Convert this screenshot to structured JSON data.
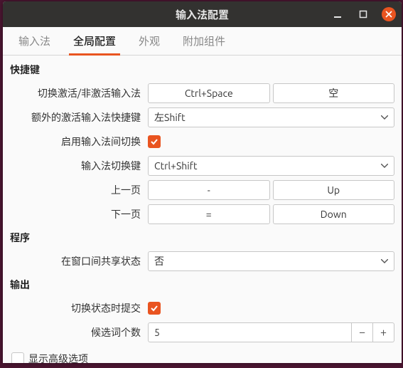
{
  "window": {
    "title": "输入法配置"
  },
  "tabs": [
    "输入法",
    "全局配置",
    "外观",
    "附加组件"
  ],
  "active_tab": 1,
  "sections": {
    "hotkey": {
      "header": "快捷键",
      "toggle_activate": {
        "label": "切换激活/非激活输入法",
        "key1": "Ctrl+Space",
        "key2": "空"
      },
      "extra_activate": {
        "label": "额外的激活输入法快捷键",
        "value": "左Shift"
      },
      "enable_switch": {
        "label": "启用输入法间切换",
        "checked": true
      },
      "switch_key": {
        "label": "输入法切换键",
        "value": "Ctrl+Shift"
      },
      "prev_page": {
        "label": "上一页",
        "key1": "-",
        "key2": "Up"
      },
      "next_page": {
        "label": "下一页",
        "key1": "=",
        "key2": "Down"
      }
    },
    "program": {
      "header": "程序",
      "share_state": {
        "label": "在窗口间共享状态",
        "value": "否"
      }
    },
    "output": {
      "header": "输出",
      "commit_on_switch": {
        "label": "切换状态时提交",
        "checked": true
      },
      "candidate_count": {
        "label": "候选词个数",
        "value": "5"
      }
    }
  },
  "footer": {
    "show_advanced": {
      "label": "显示高级选项",
      "checked": false
    }
  }
}
